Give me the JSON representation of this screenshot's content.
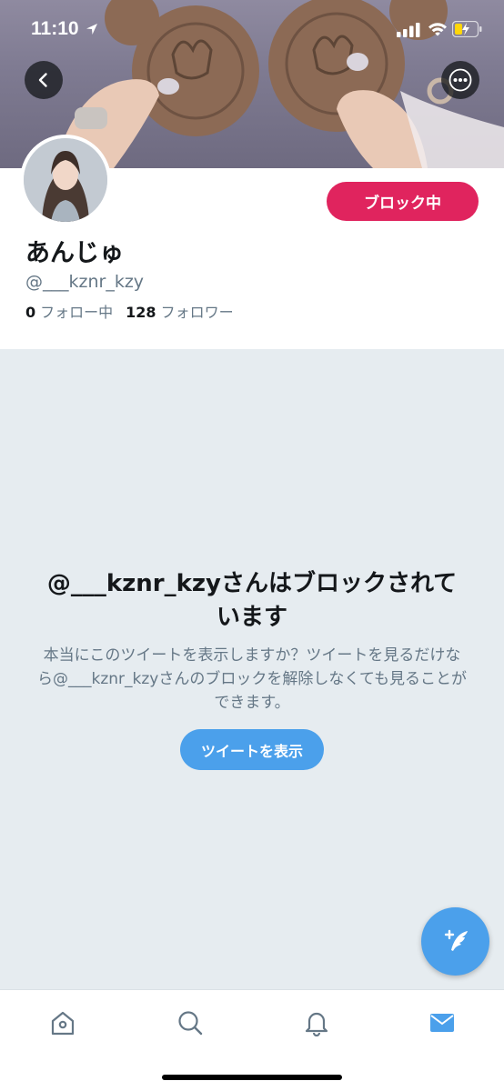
{
  "status_bar": {
    "time": "11:10"
  },
  "banner": {
    "back_icon": "chevron-left-icon",
    "more_icon": "more-horizontal-icon"
  },
  "profile": {
    "block_button_label": "ブロック中",
    "display_name": "あんじゅ",
    "handle": "@___kznr_kzy",
    "following_count": "0",
    "following_label": "フォロー中",
    "followers_count": "128",
    "followers_label": "フォロワー"
  },
  "blocked": {
    "title": "@___kznr_kzyさんはブロックされています",
    "description": "本当にこのツイートを表示しますか？ツイートを見るだけなら@___kznr_kzyさんのブロックを解除しなくても見ることができます。",
    "show_button_label": "ツイートを表示"
  },
  "fab": {
    "icon": "compose-tweet-icon"
  },
  "tab_bar": {
    "items": [
      {
        "icon": "home-icon",
        "active": false
      },
      {
        "icon": "search-icon",
        "active": false
      },
      {
        "icon": "bell-icon",
        "active": false
      },
      {
        "icon": "mail-icon",
        "active": true
      }
    ]
  },
  "colors": {
    "block_red": "#e0245e",
    "twitter_blue": "#4ba0eb",
    "background_gray": "#e6ecf0",
    "secondary_text": "#657786"
  }
}
